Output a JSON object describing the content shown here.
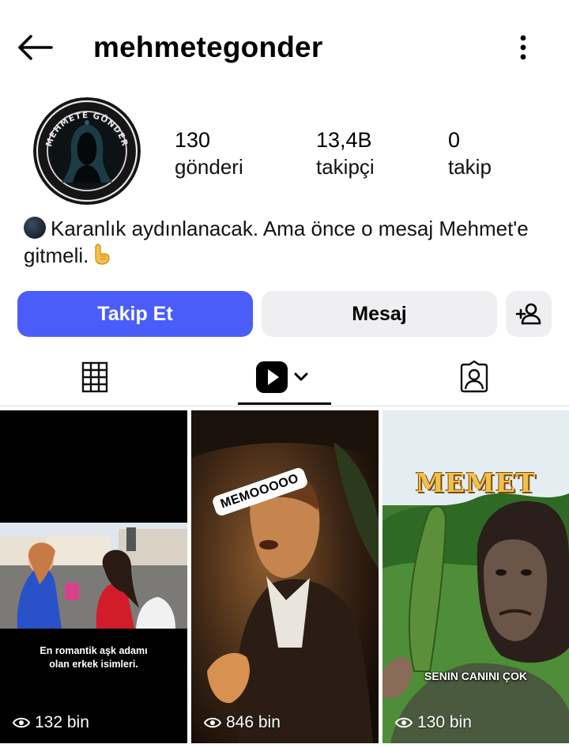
{
  "header": {
    "username": "mehmetegonder"
  },
  "profile": {
    "avatar_text": "MEHMETE GÖNDER",
    "stats": [
      {
        "value": "130",
        "label": "gönderi"
      },
      {
        "value": "13,4B",
        "label": "takipçi"
      },
      {
        "value": "0",
        "label": "takip"
      }
    ],
    "bio": "Karanlık aydınlanacak. Ama önce o mesaj Mehmet'e gitmeli."
  },
  "actions": {
    "follow_label": "Takip Et",
    "message_label": "Mesaj"
  },
  "tabs": [
    {
      "icon": "grid-icon",
      "active": false
    },
    {
      "icon": "reels-icon",
      "active": true
    },
    {
      "icon": "tagged-icon",
      "active": false
    }
  ],
  "reels": [
    {
      "caption": "En romantik aşk adamı olan erkek isimleri.",
      "views": "132 bin"
    },
    {
      "sticker": "MEMOOOOO",
      "views": "846 bin"
    },
    {
      "title": "MEMET",
      "caption": "SENIN CANINI ÇOK",
      "views": "130 bin"
    }
  ],
  "colors": {
    "follow_button": "#4a5df9",
    "secondary_button": "#efeff2"
  }
}
